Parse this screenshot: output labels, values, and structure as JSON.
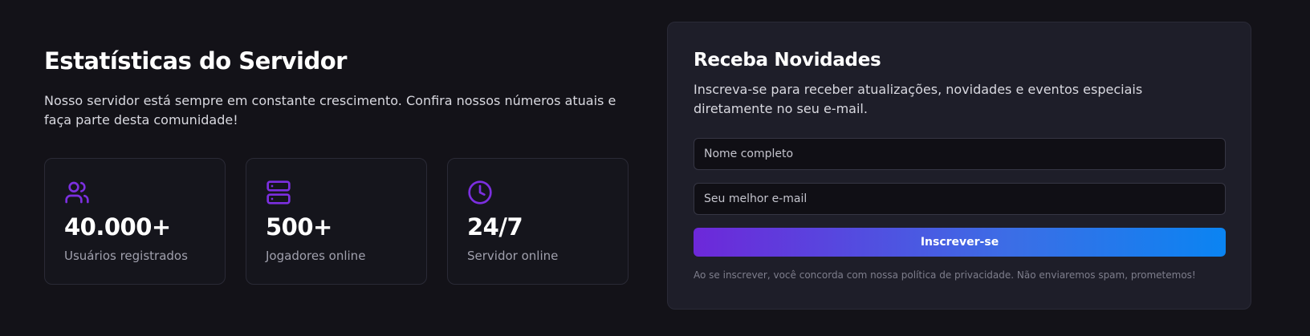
{
  "stats": {
    "title": "Estatísticas do Servidor",
    "description": "Nosso servidor está sempre em constante crescimento. Confira nossos números atuais e faça parte desta comunidade!",
    "cards": [
      {
        "icon": "users-icon",
        "value": "40.000+",
        "label": "Usuários registrados"
      },
      {
        "icon": "server-icon",
        "value": "500+",
        "label": "Jogadores online"
      },
      {
        "icon": "clock-icon",
        "value": "24/7",
        "label": "Servidor online"
      }
    ]
  },
  "newsletter": {
    "title": "Receba Novidades",
    "description": "Inscreva-se para receber atualizações, novidades e eventos especiais diretamente no seu e-mail.",
    "name_placeholder": "Nome completo",
    "email_placeholder": "Seu melhor e-mail",
    "submit_label": "Inscrever-se",
    "disclaimer": "Ao se inscrever, você concorda com nossa política de privacidade. Não enviaremos spam, prometemos!"
  },
  "colors": {
    "background": "#131218",
    "accent": "#7c2fe0",
    "button_gradient_start": "#6d28d9",
    "button_gradient_end": "#0a84f2"
  }
}
